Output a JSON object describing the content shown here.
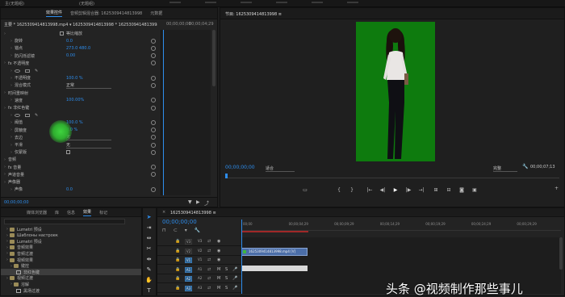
{
  "top_menu": {
    "left_text": "主(无题组)",
    "right_text": "(无题组)"
  },
  "effect_controls": {
    "tabs": [
      "效果控件",
      "音频剪辑混合器: 1625309414813998",
      "元数据"
    ],
    "header_clip": "主要 * 1625309414813998.mp4 ▾  1625309414813998 * 1625309414813998.mp4",
    "header_time": "00;00;00;00",
    "header_time2": "00;00;04;29",
    "rows": [
      {
        "indent": 0,
        "label": "",
        "value": "等比缩放",
        "checkbox": true
      },
      {
        "indent": 1,
        "label": "旋转",
        "value": "0.0",
        "reset": true
      },
      {
        "indent": 1,
        "label": "锚点",
        "value": "273.0     480.0",
        "reset": true
      },
      {
        "indent": 1,
        "label": "防闪烁滤镜",
        "value": "0.00",
        "reset": true
      },
      {
        "indent": 0,
        "label": "fx  不透明度",
        "value": "",
        "reset": true
      },
      {
        "indent": 1,
        "label": "shapes",
        "value": "",
        "shapes": true
      },
      {
        "indent": 1,
        "label": "不透明度",
        "value": "100.0 %",
        "reset": true
      },
      {
        "indent": 1,
        "label": "混合模式",
        "value": "正常",
        "dropdown": true,
        "reset": true
      },
      {
        "indent": 0,
        "label": "时间重映射",
        "value": ""
      },
      {
        "indent": 1,
        "label": "速度",
        "value": "100.00%",
        "reset": true
      },
      {
        "indent": 0,
        "label": "fx  非红色键",
        "value": "",
        "reset": true
      },
      {
        "indent": 1,
        "label": "shapes",
        "value": "",
        "shapes": true
      },
      {
        "indent": 1,
        "label": "阈值",
        "value": "100.0 %",
        "reset": true
      },
      {
        "indent": 1,
        "label": "屏蔽度",
        "value": "0.0 %",
        "reset": true
      },
      {
        "indent": 1,
        "label": "去边",
        "value": "无",
        "dropdown": true,
        "reset": true
      },
      {
        "indent": 1,
        "label": "平滑",
        "value": "无",
        "dropdown": true,
        "reset": true
      },
      {
        "indent": 1,
        "label": "仅蒙版",
        "value": "",
        "checkbox": true,
        "reset": true
      },
      {
        "indent": 0,
        "label": "音频",
        "value": ""
      },
      {
        "indent": 0,
        "label": "fx  音量",
        "value": "",
        "reset": true
      },
      {
        "indent": 0,
        "label": "声道音量",
        "value": "",
        "reset": true
      },
      {
        "indent": 0,
        "label": "声像器",
        "value": ""
      },
      {
        "indent": 1,
        "label": "声像",
        "value": "0.0",
        "reset": true
      }
    ],
    "footer_time": "00;00;00;00"
  },
  "program_monitor": {
    "title": "节目: 1625309414813998 ≡",
    "timecode": "00;00;00;00",
    "fit": "适合",
    "quality": "完整",
    "duration": "00;00;07;13",
    "transport": [
      "{",
      "}",
      "|←",
      "◀|",
      "▶",
      "|▶",
      "→|",
      "⊞",
      "⊟",
      "📷"
    ]
  },
  "project_panel": {
    "tabs": [
      "媒体浏览器",
      "库",
      "信息",
      "效果",
      "标记"
    ],
    "search": "",
    "items": [
      {
        "indent": 1,
        "label": "Lumetri 预设",
        "folder": true
      },
      {
        "indent": 1,
        "label": "Шаблоны настроек",
        "folder": true
      },
      {
        "indent": 1,
        "label": "Lumetri 预设",
        "folder": true
      },
      {
        "indent": 1,
        "label": "音频效果",
        "folder": true
      },
      {
        "indent": 1,
        "label": "音频过渡",
        "folder": true
      },
      {
        "indent": 1,
        "label": "视频效果",
        "folder": true
      },
      {
        "indent": 2,
        "label": "键控",
        "folder": true
      },
      {
        "indent": 3,
        "label": "非红色键",
        "folder": false,
        "selected": true
      },
      {
        "indent": 1,
        "label": "视频过渡",
        "folder": true
      },
      {
        "indent": 2,
        "label": "溶解",
        "folder": true
      },
      {
        "indent": 3,
        "label": "黑场过渡",
        "folder": false
      }
    ]
  },
  "timeline": {
    "tab": "1625309414813998 ≡",
    "timecode": "00;00;00;00",
    "ruler": [
      "00;00",
      "00;00;04;29",
      "00;00;09;29",
      "00;00;14;29",
      "00;00;19;29",
      "00;00;24;29",
      "00;00;29;29"
    ],
    "tracks": [
      {
        "name": "V3",
        "on": false
      },
      {
        "name": "V2",
        "on": false
      },
      {
        "name": "V1",
        "on": true
      },
      {
        "name": "A1",
        "on": true
      },
      {
        "name": "A2",
        "on": true
      },
      {
        "name": "A3",
        "on": true
      }
    ],
    "clip_label": "1625309414813998.mp4 [V]"
  },
  "watermark": "头条 @视频制作那些事儿"
}
